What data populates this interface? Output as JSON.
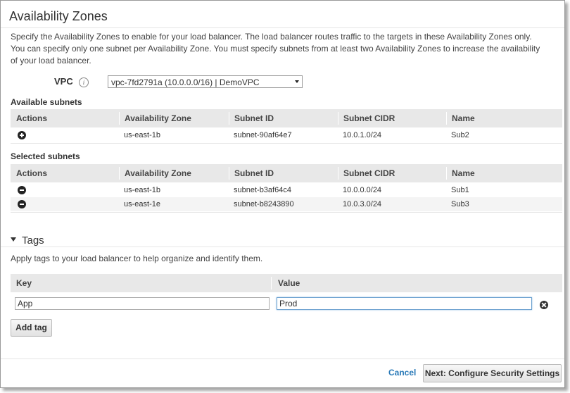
{
  "page": {
    "title": "Availability Zones",
    "description": "Specify the Availability Zones to enable for your load balancer. The load balancer routes traffic to the targets in these Availability Zones only. You can specify only one subnet per Availability Zone. You must specify subnets from at least two Availability Zones to increase the availability of your load balancer."
  },
  "vpc": {
    "label": "VPC",
    "info_icon": "i",
    "selected": "vpc-7fd2791a (10.0.0.0/16) | DemoVPC"
  },
  "columns": [
    "Actions",
    "Availability Zone",
    "Subnet ID",
    "Subnet CIDR",
    "Name"
  ],
  "available_subnets": {
    "label": "Available subnets",
    "rows": [
      {
        "action_icon": "plus-circle-icon",
        "az": "us-east-1b",
        "subnet_id": "subnet-90af64e7",
        "cidr": "10.0.1.0/24",
        "name": "Sub2"
      }
    ]
  },
  "selected_subnets": {
    "label": "Selected subnets",
    "rows": [
      {
        "action_icon": "minus-circle-icon",
        "az": "us-east-1b",
        "subnet_id": "subnet-b3af64c4",
        "cidr": "10.0.0.0/24",
        "name": "Sub1"
      },
      {
        "action_icon": "minus-circle-icon",
        "az": "us-east-1e",
        "subnet_id": "subnet-b8243890",
        "cidr": "10.0.3.0/24",
        "name": "Sub3"
      }
    ]
  },
  "tags": {
    "title": "Tags",
    "description": "Apply tags to your load balancer to help organize and identify them.",
    "key_header": "Key",
    "value_header": "Value",
    "rows": [
      {
        "key": "App",
        "value": "Prod"
      }
    ],
    "add_tag_label": "Add tag"
  },
  "footer": {
    "cancel_label": "Cancel",
    "next_label": "Next: Configure Security Settings"
  },
  "colors": {
    "link": "#2a7ab8",
    "header_bg": "#e8e8e8"
  }
}
